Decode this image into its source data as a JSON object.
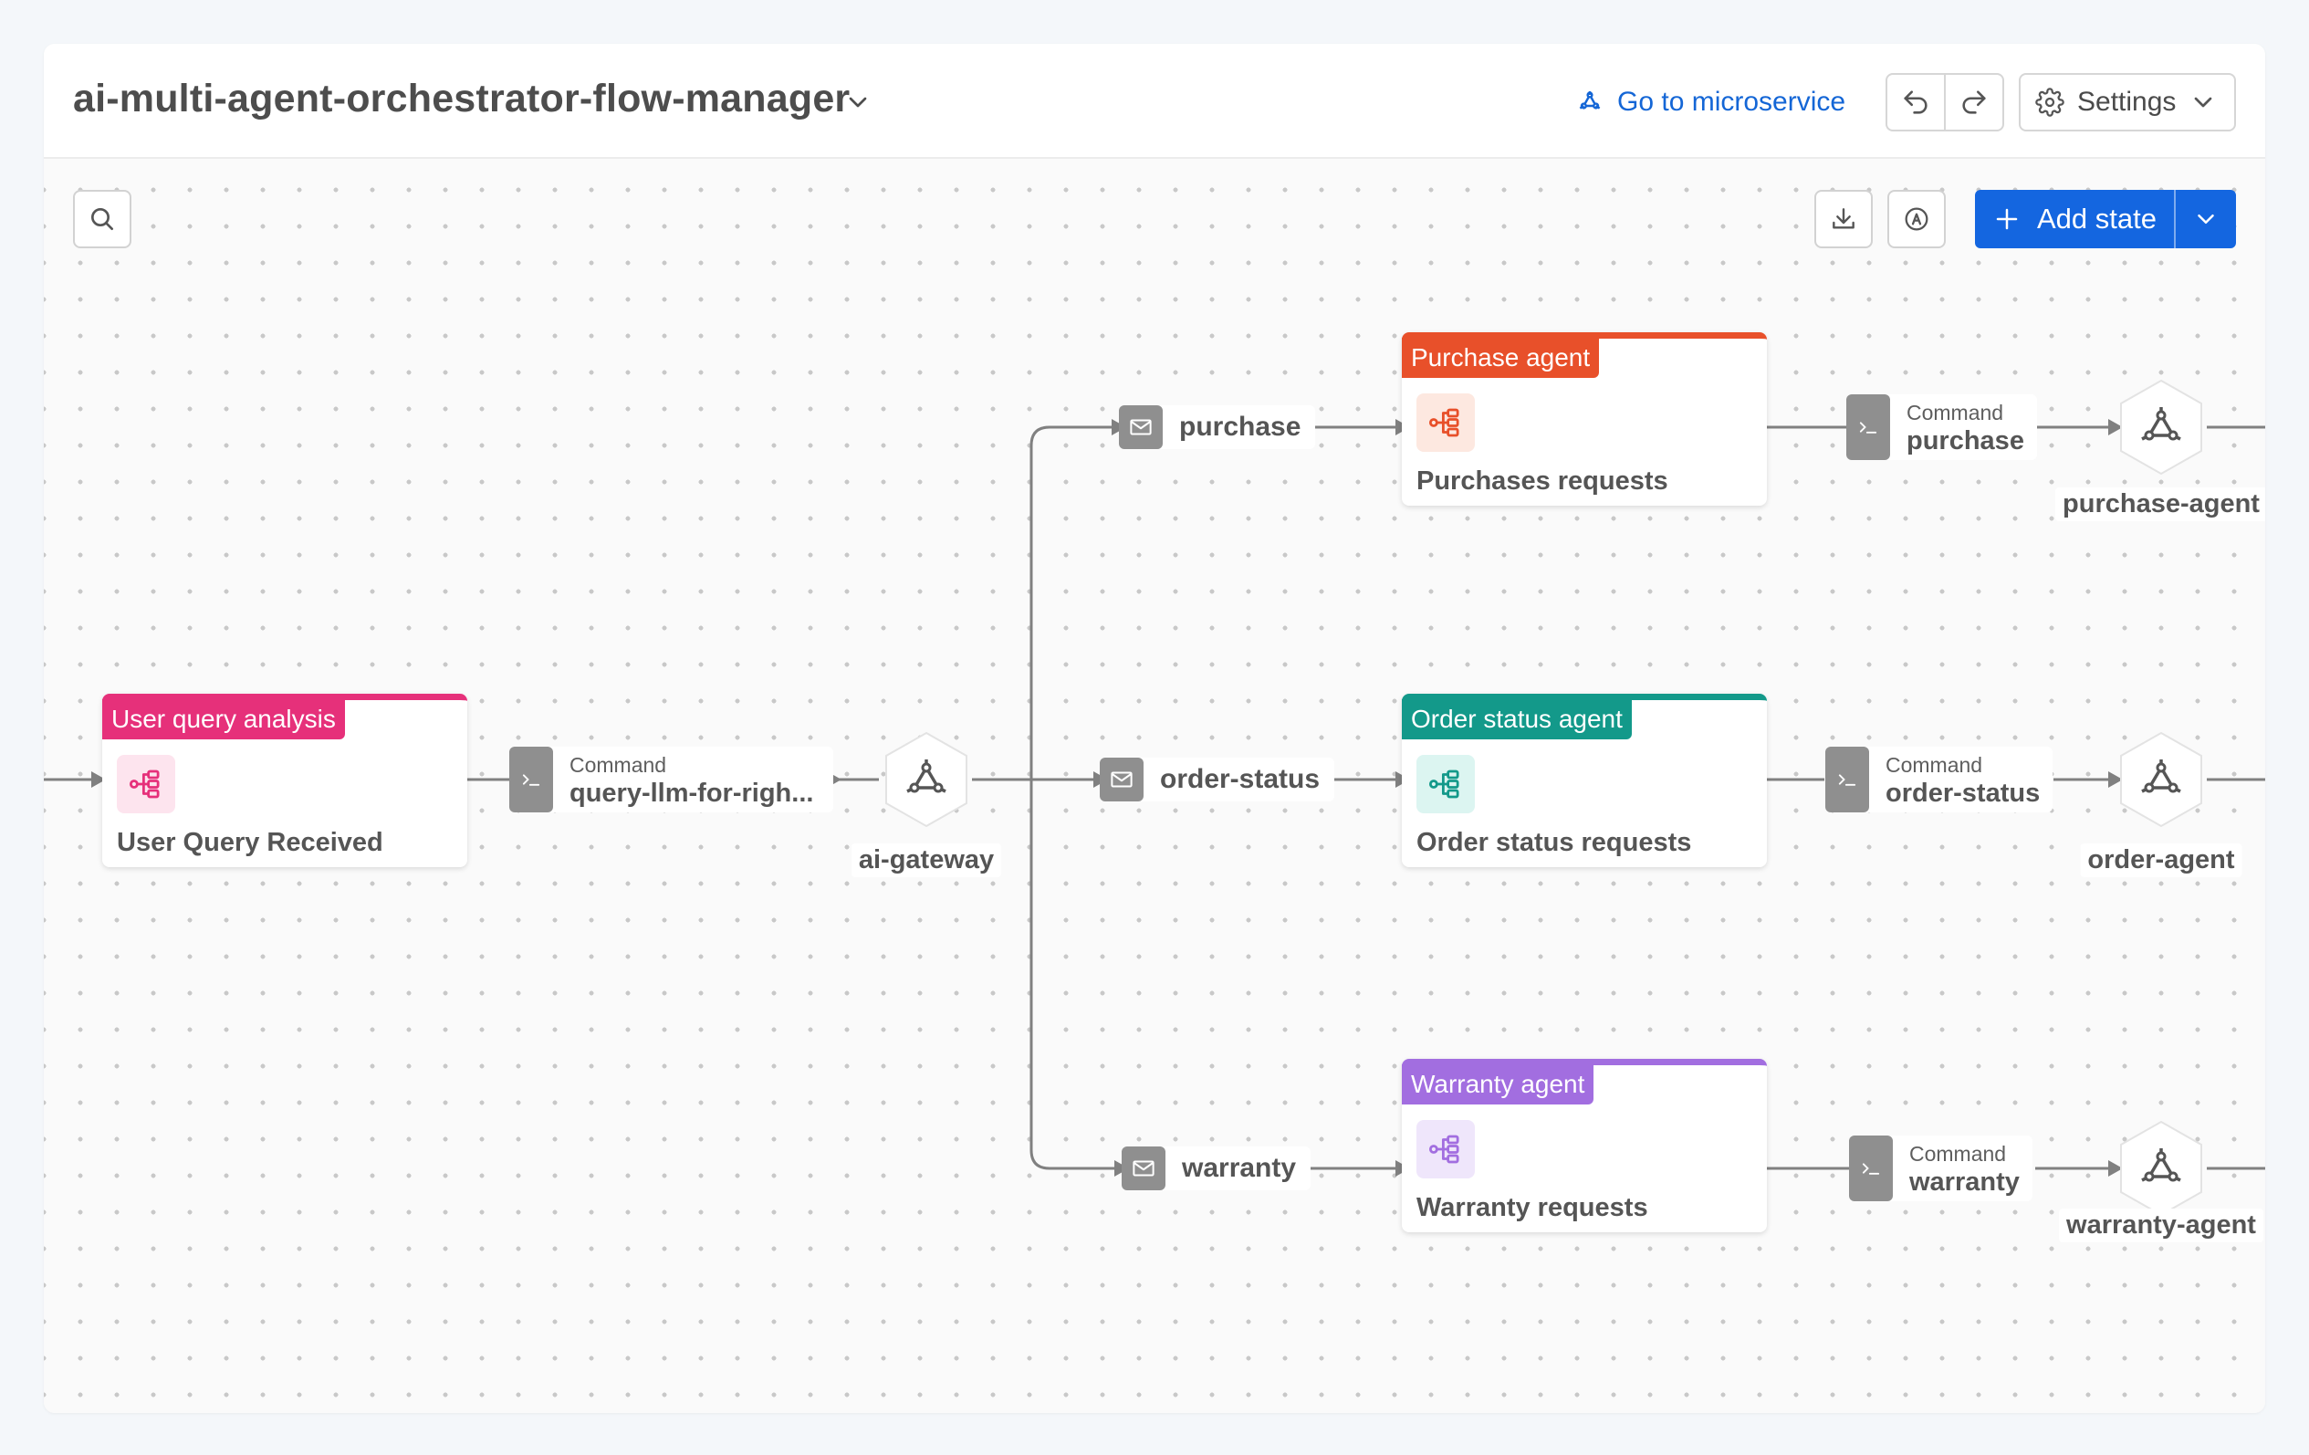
{
  "header": {
    "title": "ai-multi-agent-orchestrator-flow-manager",
    "goto_label": "Go to microservice",
    "settings_label": "Settings"
  },
  "toolbar": {
    "add_state_label": "Add state"
  },
  "colors": {
    "accent": "#1466e0",
    "link": "#1466d6",
    "user_query_tag": "#e6307a",
    "purchase_tag": "#e8502a",
    "order_status_tag": "#13998a",
    "warranty_tag": "#a26ee0"
  },
  "states": {
    "user_query": {
      "tag": "User query analysis",
      "name": "User Query Received"
    },
    "purchase": {
      "tag": "Purchase agent",
      "name": "Purchases requests"
    },
    "order_status": {
      "tag": "Order status agent",
      "name": "Order status requests"
    },
    "warranty": {
      "tag": "Warranty agent",
      "name": "Warranty requests"
    }
  },
  "events": {
    "purchase": "purchase",
    "order_status": "order-status",
    "warranty": "warranty"
  },
  "commands": {
    "kind": "Command",
    "query": "query-llm-for-righ...",
    "purchase": "purchase",
    "order_status": "order-status",
    "warranty": "warranty"
  },
  "services": {
    "gateway": "ai-gateway",
    "purchase": "purchase-agent",
    "order": "order-agent",
    "warranty": "warranty-agent"
  },
  "icons": {
    "title_dropdown": "chevron-down-icon",
    "goto": "microservice-icon",
    "undo": "undo-icon",
    "redo": "redo-icon",
    "settings": "gear-icon",
    "search": "search-icon",
    "download": "download-icon",
    "autolayout": "auto-layout-icon",
    "add": "plus-icon",
    "state": "flow-branch-icon",
    "event": "envelope-icon",
    "command": "terminal-icon",
    "service": "hexagon-service-icon"
  }
}
